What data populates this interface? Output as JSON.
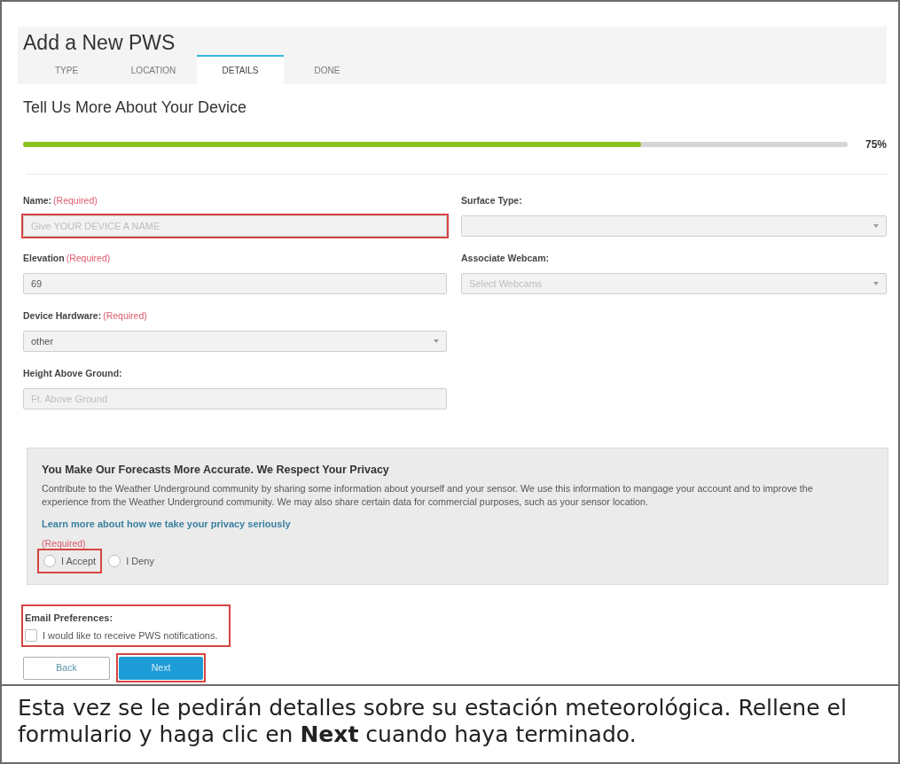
{
  "header": {
    "title": "Add a New PWS",
    "tabs": [
      {
        "label": "TYPE",
        "selected": false
      },
      {
        "label": "LOCATION",
        "selected": false
      },
      {
        "label": "DETAILS",
        "selected": true
      },
      {
        "label": "DONE",
        "selected": false
      }
    ]
  },
  "section_title": "Tell Us More About Your Device",
  "progress": {
    "level": 0.75,
    "reading": "75%"
  },
  "left_fields": [
    {
      "kind": "input",
      "label": "Name:",
      "required_note": "(Required)",
      "placeholder": "Give YOUR DEVICE A NAME",
      "outlined": true
    },
    {
      "kind": "input",
      "label": "Elevation",
      "required_note": "(Required)",
      "value": "69",
      "outlined": false
    },
    {
      "kind": "select",
      "label": "Device Hardware:",
      "required_note": "(Required)",
      "value": "other",
      "outlined": false
    },
    {
      "kind": "input",
      "label": "Height Above Ground:",
      "placeholder": "Ft. Above Ground",
      "outlined": false
    }
  ],
  "right_fields": [
    {
      "kind": "select",
      "label": "Surface Type:",
      "outlined": false
    },
    {
      "kind": "select",
      "label": "Associate Webcam:",
      "placeholder": "Select Webcams",
      "outlined": false
    }
  ],
  "privacy": {
    "title": "You Make Our Forecasts More Accurate. We Respect Your Privacy",
    "text": "Contribute to the Weather Underground community by sharing some information about yourself and your sensor. We use this information to mangage your account and to improve the experience from the Weather Underground community. We may also share certain data for commercial purposes, such as your sensor location.",
    "link": "Learn more about how we take your privacy seriously",
    "required_note": "(Required)",
    "options": [
      {
        "label": "I Accept",
        "selected": false,
        "outlined": true
      },
      {
        "label": "I Deny",
        "selected": false,
        "outlined": false
      }
    ]
  },
  "email_preferences": {
    "title": "Email Preferences:",
    "outlined": true,
    "option": {
      "label": "I would like to receive PWS notifications.",
      "checked": false
    }
  },
  "buttons": [
    {
      "label": "Back",
      "kind": "secondary",
      "outlined": false
    },
    {
      "label": "Next",
      "kind": "primary",
      "outlined": true
    }
  ],
  "caption": "Esta vez se le pedirán detalles sobre su estación meteorológica. Rellene el formulario y haga clic en **Next** cuando haya terminado."
}
